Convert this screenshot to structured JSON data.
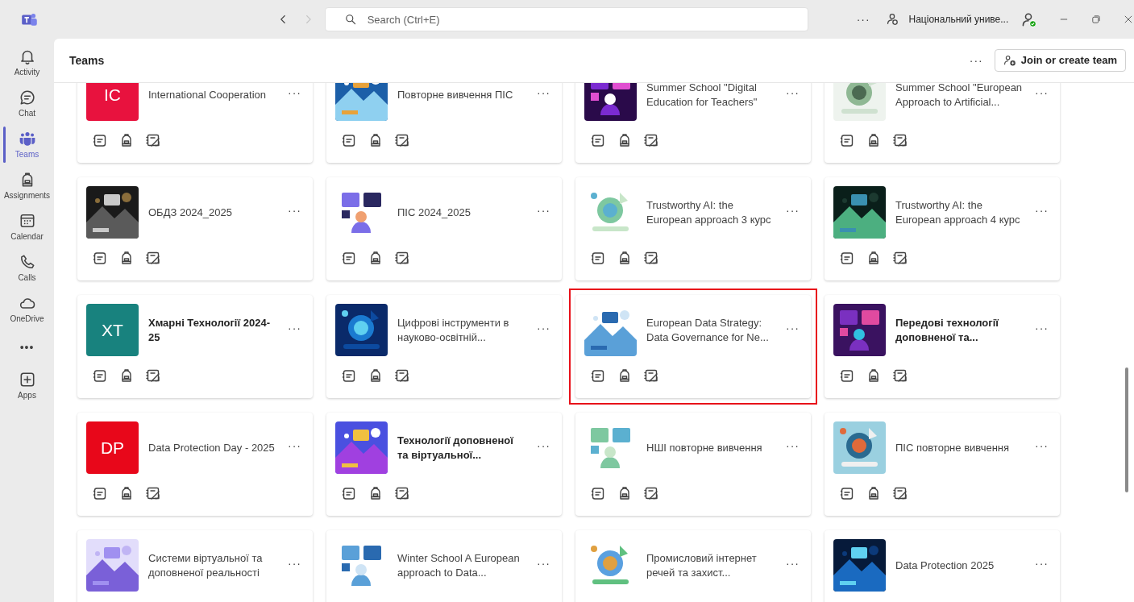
{
  "titlebar": {
    "search": {
      "placeholder": "Search (Ctrl+E)"
    },
    "more": "···",
    "org_name": "Національний униве...",
    "forward_disabled": true
  },
  "rail": [
    {
      "label": "Activity",
      "selected": false
    },
    {
      "label": "Chat",
      "selected": false
    },
    {
      "label": "Teams",
      "selected": true
    },
    {
      "label": "Assignments",
      "selected": false
    },
    {
      "label": "Calendar",
      "selected": false
    },
    {
      "label": "Calls",
      "selected": false
    },
    {
      "label": "OneDrive",
      "selected": false
    },
    {
      "label": "•••",
      "selected": false
    },
    {
      "label": "Apps",
      "selected": false
    }
  ],
  "header": {
    "title": "Teams",
    "more": "···",
    "join_button": "Join or create team"
  },
  "teams": [
    {
      "name": "International Cooperation",
      "bold": false,
      "highlighted": false,
      "avatar": {
        "kind": "initials",
        "text": "IC",
        "color": "#e8123e"
      },
      "more": "···"
    },
    {
      "name": "Повторне вивчення ПІС",
      "bold": false,
      "highlighted": false,
      "more": "···"
    },
    {
      "name": "Summer School \"Digital Education for Teachers\"",
      "bold": false,
      "highlighted": false,
      "more": "···"
    },
    {
      "name": "Summer School \"European Approach to Artificial...",
      "bold": false,
      "highlighted": false,
      "more": "···"
    },
    {
      "name": "ОБДЗ 2024_2025",
      "bold": false,
      "highlighted": false,
      "more": "···"
    },
    {
      "name": "ПІС 2024_2025",
      "bold": false,
      "highlighted": false,
      "more": "···"
    },
    {
      "name": "Trustworthy AI: the European approach 3 курс",
      "bold": false,
      "highlighted": false,
      "more": "···"
    },
    {
      "name": "Trustworthy AI: the European approach 4 курс",
      "bold": false,
      "highlighted": false,
      "more": "···"
    },
    {
      "name": "Хмарні Технології 2024-25",
      "bold": true,
      "highlighted": false,
      "avatar": {
        "kind": "initials",
        "text": "XT",
        "color": "#18827e"
      },
      "more": "···"
    },
    {
      "name": "Цифрові інструменти в науково-освітній...",
      "bold": false,
      "highlighted": false,
      "more": "···"
    },
    {
      "name": "European Data Strategy: Data Governance for Ne...",
      "bold": false,
      "highlighted": true,
      "more": "···"
    },
    {
      "name": "Передові технології доповненої та...",
      "bold": true,
      "highlighted": false,
      "more": "···"
    },
    {
      "name": "Data Protection Day - 2025",
      "bold": false,
      "highlighted": false,
      "avatar": {
        "kind": "initials",
        "text": "DP",
        "color": "#e8071a"
      },
      "more": "···"
    },
    {
      "name": "Технології доповненої та віртуальної...",
      "bold": true,
      "highlighted": false,
      "more": "···"
    },
    {
      "name": "НШІ повторне вивчення",
      "bold": false,
      "highlighted": false,
      "more": "···"
    },
    {
      "name": "ПІС повторне вивчення",
      "bold": false,
      "highlighted": false,
      "more": "···"
    },
    {
      "name": "Системи віртуальної та доповненої реальності",
      "bold": false,
      "highlighted": false,
      "more": "···"
    },
    {
      "name": "Winter School A European approach to Data...",
      "bold": false,
      "highlighted": false,
      "more": "···"
    },
    {
      "name": "Промисловий інтернет речей та захист...",
      "bold": false,
      "highlighted": false,
      "more": "···"
    },
    {
      "name": "Data Protection 2025",
      "bold": false,
      "highlighted": false,
      "more": "···"
    }
  ]
}
